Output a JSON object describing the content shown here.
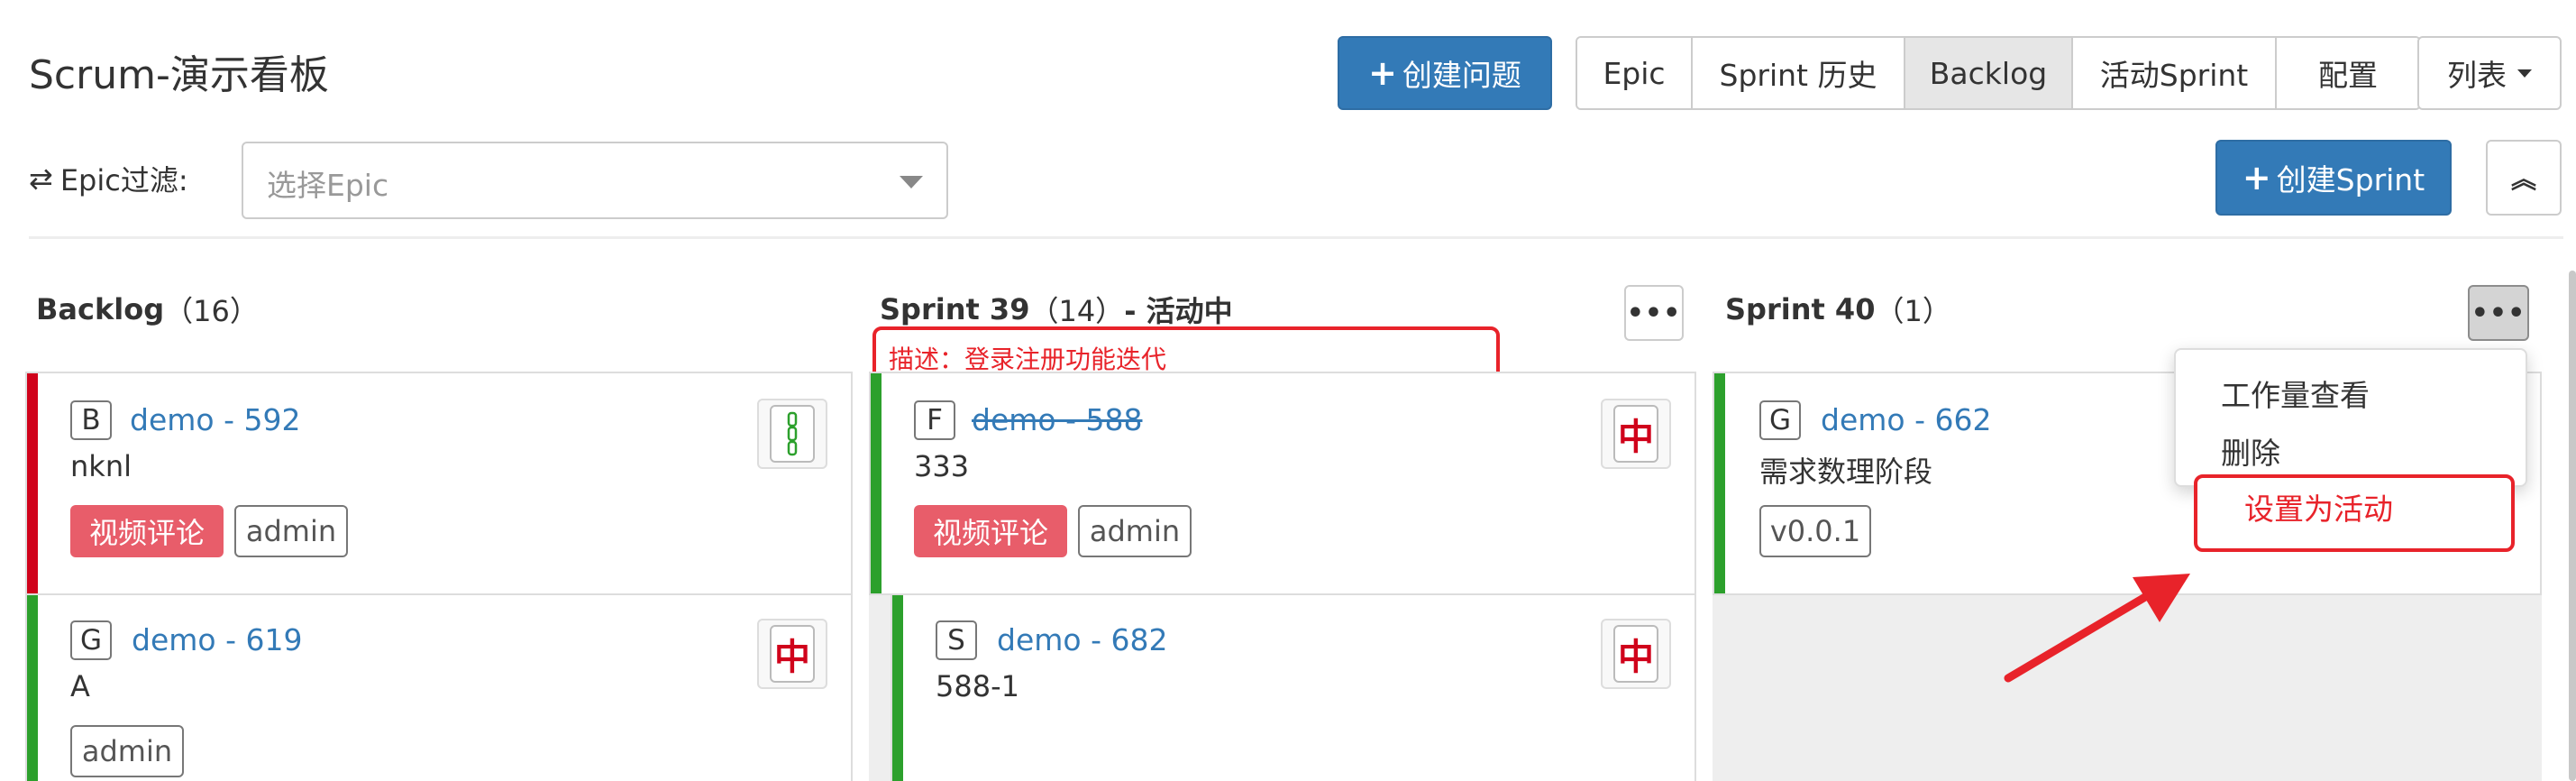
{
  "page": {
    "title": "Scrum-演示看板"
  },
  "toolbar": {
    "create_issue": "创建问题",
    "views": [
      "Epic",
      "Sprint 历史",
      "Backlog",
      "活动Sprint",
      "配置"
    ],
    "active_view": "Backlog",
    "list_label": "列表",
    "create_sprint": "创建Sprint",
    "collapse_icon": "double-chevron-up-icon"
  },
  "filter": {
    "label": "Epic过滤:",
    "placeholder": "选择Epic"
  },
  "columns": {
    "backlog": {
      "title": "Backlog",
      "count": "（16）",
      "cards": [
        {
          "type": "B",
          "key": "demo - 592",
          "summary": "nknl",
          "tags": [
            "视频评论"
          ],
          "assignee": "admin",
          "priority_icon": "bamboo-tile-icon",
          "bar_color": "#d0021b"
        },
        {
          "type": "G",
          "key": "demo - 619",
          "summary": "A",
          "tags": [],
          "assignee": "admin",
          "priority_icon": "red-dragon-tile-icon",
          "bar_color": "#2ca02c"
        }
      ]
    },
    "sprint39": {
      "title": "Sprint 39",
      "count": "（14）",
      "status": " - 活动中",
      "description": "描述：登录注册功能迭代",
      "cards": [
        {
          "type": "F",
          "key": "demo - 588",
          "summary": "333",
          "tags": [
            "视频评论"
          ],
          "assignee": "admin",
          "priority_icon": "red-dragon-tile-icon",
          "bar_color": "#2ca02c",
          "done": true
        },
        {
          "type": "S",
          "key": "demo - 682",
          "summary": "588-1",
          "tags": [],
          "assignee": "",
          "priority_icon": "red-dragon-tile-icon",
          "bar_color": "#2ca02c"
        }
      ]
    },
    "sprint40": {
      "title": "Sprint 40",
      "count": "（1）",
      "cards": [
        {
          "type": "G",
          "key": "demo - 662",
          "summary": "需求数理阶段",
          "version": "v0.0.1",
          "bar_color": "#2ca02c"
        }
      ],
      "menu": [
        "工作量查看",
        "删除",
        "设置为活动"
      ]
    }
  },
  "colors": {
    "primary": "#337ab7",
    "annotation_red": "#e8232a",
    "tag_red": "#e85d6a",
    "bar_green": "#2ca02c",
    "bar_red": "#d0021b"
  },
  "tile_glyphs": {
    "red_dragon": "中"
  }
}
